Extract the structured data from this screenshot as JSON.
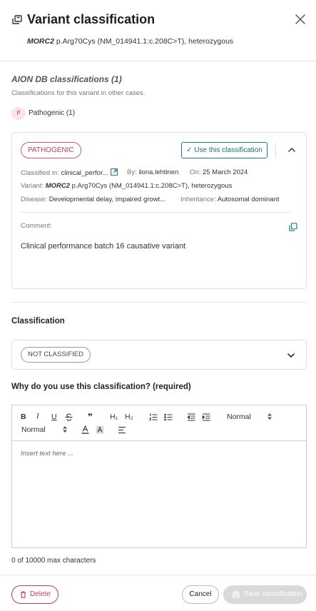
{
  "header": {
    "title": "Variant classification",
    "gene": "MORC2",
    "variant_desc": " p.Arg70Cys (NM_014941.1:c.208C>T), heterozygous"
  },
  "db_section": {
    "title": "AION DB classifications (1)",
    "subtitle": "Classifications for this variant in other cases.",
    "badge_letter": "P",
    "count_label": "Pathogenic (1)"
  },
  "card": {
    "tag": "PATHOGENIC",
    "use_button": "✓ Use this classification",
    "classified_in_label": "Classified in:",
    "classified_in_value": "clinical_perfor...",
    "by_label": "By:",
    "by_value": "ilona.lehtinen",
    "on_label": "On:",
    "on_value": "25 March 2024",
    "variant_label": "Variant:",
    "variant_gene": "MORC2",
    "variant_value": " p.Arg70Cys (NM_014941.1:c.208C>T), heterozygous",
    "disease_label": "Disease:",
    "disease_value": "Developmental delay, impaired growt...",
    "inheritance_label": "Inheritance:",
    "inheritance_value": "Autosomal dominant",
    "comment_label": "Comment:",
    "comment_text": "Clinical performance batch 16 causative variant"
  },
  "classification": {
    "label": "Classification",
    "selected": "NOT CLASSIFIED"
  },
  "reason": {
    "label": "Why do you use this classification? (required)",
    "placeholder": "Insert text here ...",
    "char_count": "0 of 10000 max characters",
    "toolbar": {
      "bold": "B",
      "italic": "I",
      "underline": "U",
      "quote": "❞",
      "h1": "H₁",
      "h2": "H₂",
      "size_select": "Normal",
      "font_select": "Normal"
    }
  },
  "footer": {
    "delete_label": "Delete",
    "cancel_label": "Cancel",
    "save_label": "Save classification"
  },
  "colors": {
    "pathogenic": "#c24054",
    "accent": "#1f7f80",
    "disabled": "#d9d9d9"
  }
}
